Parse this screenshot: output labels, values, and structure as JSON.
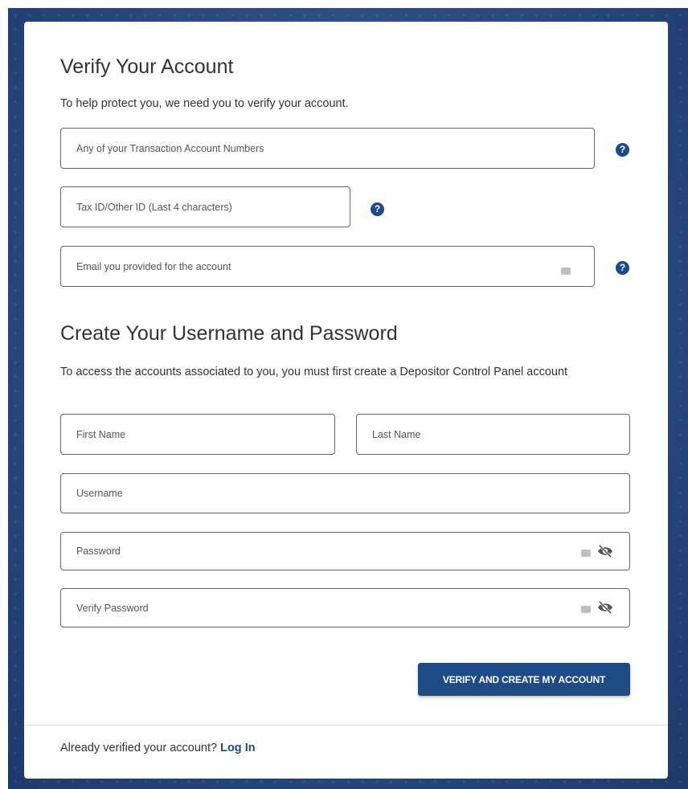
{
  "verify_section": {
    "title": "Verify Your Account",
    "description": "To help protect you, we need you to verify your account.",
    "account_numbers_placeholder": "Any of your Transaction Account Numbers",
    "tax_id_placeholder": "Tax ID/Other ID (Last 4 characters)",
    "email_placeholder": "Email you provided for the account",
    "help_glyph": "?"
  },
  "create_section": {
    "title": "Create Your Username and Password",
    "description": "To access the accounts associated to you, you must first create a Depositor Control Panel account",
    "first_name_placeholder": "First Name",
    "last_name_placeholder": "Last Name",
    "username_placeholder": "Username",
    "password_placeholder": "Password",
    "verify_password_placeholder": "Verify Password"
  },
  "submit_label": "VERIFY AND CREATE MY ACCOUNT",
  "footer": {
    "text": "Already verified your account?",
    "link_label": "Log In"
  },
  "icons": {
    "help": "question-circle-icon",
    "autofill": "keyboard-autofill-icon",
    "toggle_visibility": "eye-slash-icon"
  },
  "colors": {
    "accent": "#1e4b86",
    "background": "#2a4a80"
  }
}
